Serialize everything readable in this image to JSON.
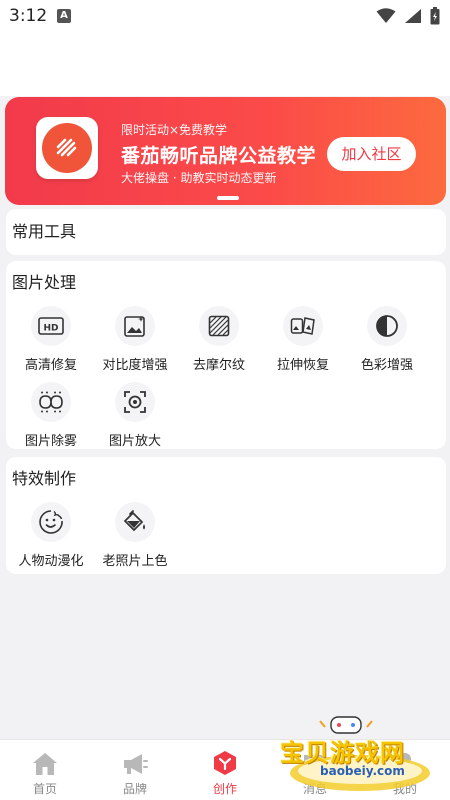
{
  "status_bar": {
    "time": "3:12",
    "notification": "A"
  },
  "banner": {
    "subtitle": "限时活动×免费教学",
    "title": "番茄畅听品牌公益教学",
    "description": "大佬操盘 · 助教实时动态更新",
    "button_label": "加入社区"
  },
  "sections": {
    "common_tools": {
      "title": "常用工具"
    },
    "image_processing": {
      "title": "图片处理",
      "tools": [
        {
          "label": "高清修复",
          "icon": "hd-icon"
        },
        {
          "label": "对比度增强",
          "icon": "image-contrast-icon"
        },
        {
          "label": "去摩尔纹",
          "icon": "moire-icon"
        },
        {
          "label": "拉伸恢复",
          "icon": "stretch-icon"
        },
        {
          "label": "色彩增强",
          "icon": "color-contrast-icon"
        },
        {
          "label": "图片除雾",
          "icon": "defog-icon"
        },
        {
          "label": "图片放大",
          "icon": "zoom-icon"
        }
      ]
    },
    "effects": {
      "title": "特效制作",
      "tools": [
        {
          "label": "人物动漫化",
          "icon": "anime-face-icon"
        },
        {
          "label": "老照片上色",
          "icon": "paint-bucket-icon"
        }
      ]
    }
  },
  "bottom_nav": {
    "items": [
      {
        "label": "首页",
        "icon": "home-icon"
      },
      {
        "label": "品牌",
        "icon": "megaphone-icon"
      },
      {
        "label": "创作",
        "icon": "create-icon",
        "active": true
      },
      {
        "label": "消息",
        "icon": "message-icon"
      },
      {
        "label": "我的",
        "icon": "profile-icon"
      }
    ]
  },
  "watermark": {
    "text": "宝贝游戏网",
    "url": "baobeiy.com"
  },
  "colors": {
    "accent": "#f03a45",
    "banner_start": "#f23a4b",
    "banner_end": "#fc6a3e",
    "background": "#f2f2f4"
  }
}
